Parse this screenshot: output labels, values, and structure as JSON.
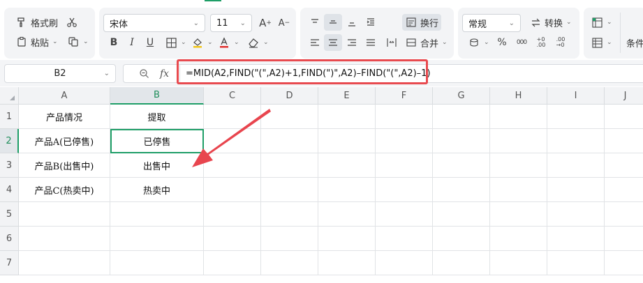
{
  "ribbon": {
    "format_painter": "格式刷",
    "paste": "粘贴",
    "font_name": "宋体",
    "font_size": "11",
    "wrap_text": "换行",
    "merge": "合并",
    "number_format": "常规",
    "convert": "转换",
    "conditional_partial": "条件"
  },
  "formula_bar": {
    "name_box": "B2",
    "fx_label": "fx",
    "formula": "=MID(A2,FIND(\"(\",A2)+1,FIND(\")\",A2)–FIND(\"(\",A2)–1)"
  },
  "sheet": {
    "columns": [
      "A",
      "B",
      "C",
      "D",
      "E",
      "F",
      "G",
      "H",
      "I",
      "J"
    ],
    "rows": [
      "1",
      "2",
      "3",
      "4",
      "5",
      "6",
      "7"
    ],
    "selected_column": "B",
    "selected_row": "2",
    "cells": {
      "A1": "产品情况",
      "B1": "提取",
      "A2": "产品A(已停售)",
      "B2": "已停售",
      "A3": "产品B(出售中)",
      "B3": "出售中",
      "A4": "产品C(热卖中)",
      "B4": "热卖中"
    }
  },
  "colors": {
    "accent_green": "#1e9e67",
    "highlight_red": "#e84a4f",
    "arrow_red": "#e8454e"
  }
}
